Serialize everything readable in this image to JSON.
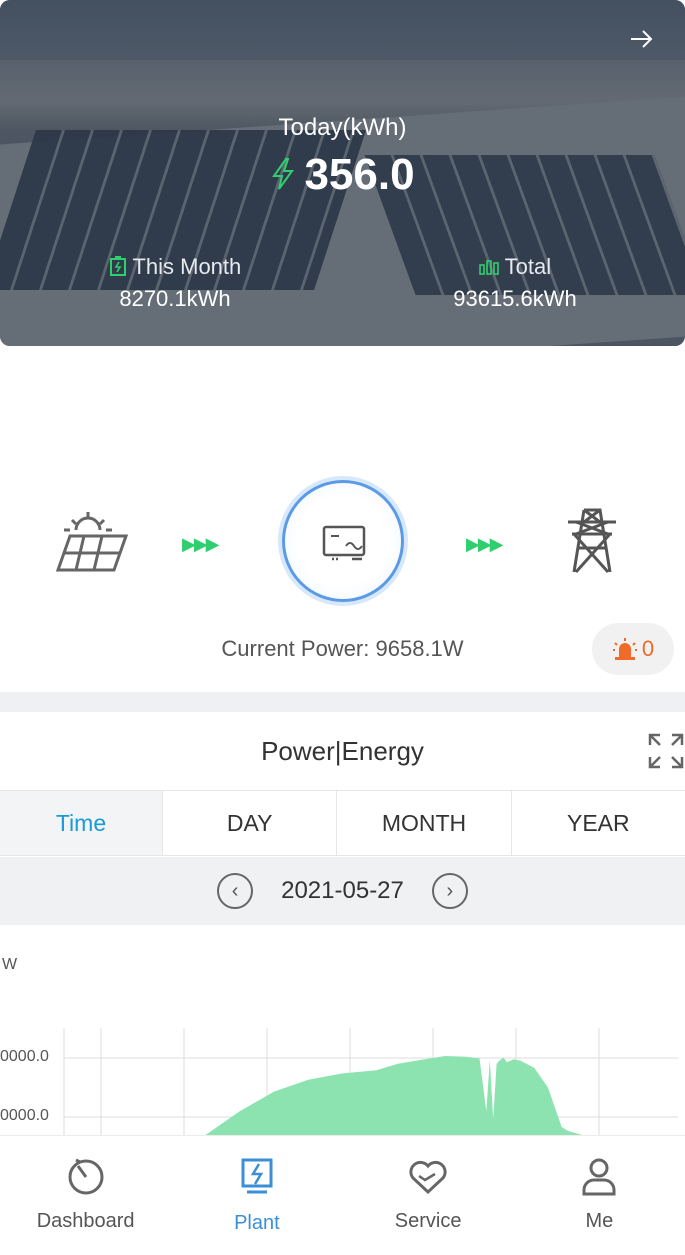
{
  "hero": {
    "today_label": "Today(kWh)",
    "today_value": "356.0",
    "this_month_label": "This Month",
    "this_month_value": "8270.1kWh",
    "total_label": "Total",
    "total_value": "93615.6kWh",
    "arrow_icon": "arrow-right-icon"
  },
  "flow": {
    "current_power_label": "Current Power:",
    "current_power_value": "9658.1W",
    "alarm_count": "0",
    "arrow_color": "#2fcf6f",
    "inverter_ring_color": "#5b9be6"
  },
  "chart_section": {
    "title": "Power|Energy",
    "tabs": [
      "Time",
      "DAY",
      "MONTH",
      "YEAR"
    ],
    "active_tab": "Time",
    "date": "2021-05-27",
    "prev_icon": "chevron-left-icon",
    "next_icon": "chevron-right-icon"
  },
  "chart_data": {
    "type": "area",
    "ylabel": "W",
    "ytick_labels": [
      "0000.0",
      "0000.0"
    ],
    "series": [
      {
        "color": "#8ce3b0",
        "x": [
          0,
          0.3,
          0.35,
          0.4,
          0.45,
          0.5,
          0.55,
          0.58,
          0.62,
          0.65,
          0.68,
          0.7,
          0.71,
          0.715,
          0.72,
          0.725,
          0.73,
          0.735,
          0.74,
          0.75,
          0.76,
          0.78,
          0.8,
          0.82,
          0.83,
          0.85,
          1
        ],
        "values": [
          0,
          0,
          0.3,
          0.55,
          0.7,
          0.78,
          0.82,
          0.9,
          0.96,
          1.0,
          0.99,
          0.97,
          0.3,
          0.95,
          0.2,
          0.9,
          0.95,
          0.98,
          0.92,
          0.96,
          0.94,
          0.85,
          0.6,
          0.1,
          0.05,
          0,
          0
        ]
      }
    ]
  },
  "bottom_nav": {
    "items": [
      {
        "label": "Dashboard",
        "icon": "dashboard-gauge-icon"
      },
      {
        "label": "Plant",
        "icon": "plant-bolt-icon"
      },
      {
        "label": "Service",
        "icon": "service-heart-icon"
      },
      {
        "label": "Me",
        "icon": "user-icon"
      }
    ],
    "active": "Plant",
    "active_color": "#3a8fd6"
  }
}
